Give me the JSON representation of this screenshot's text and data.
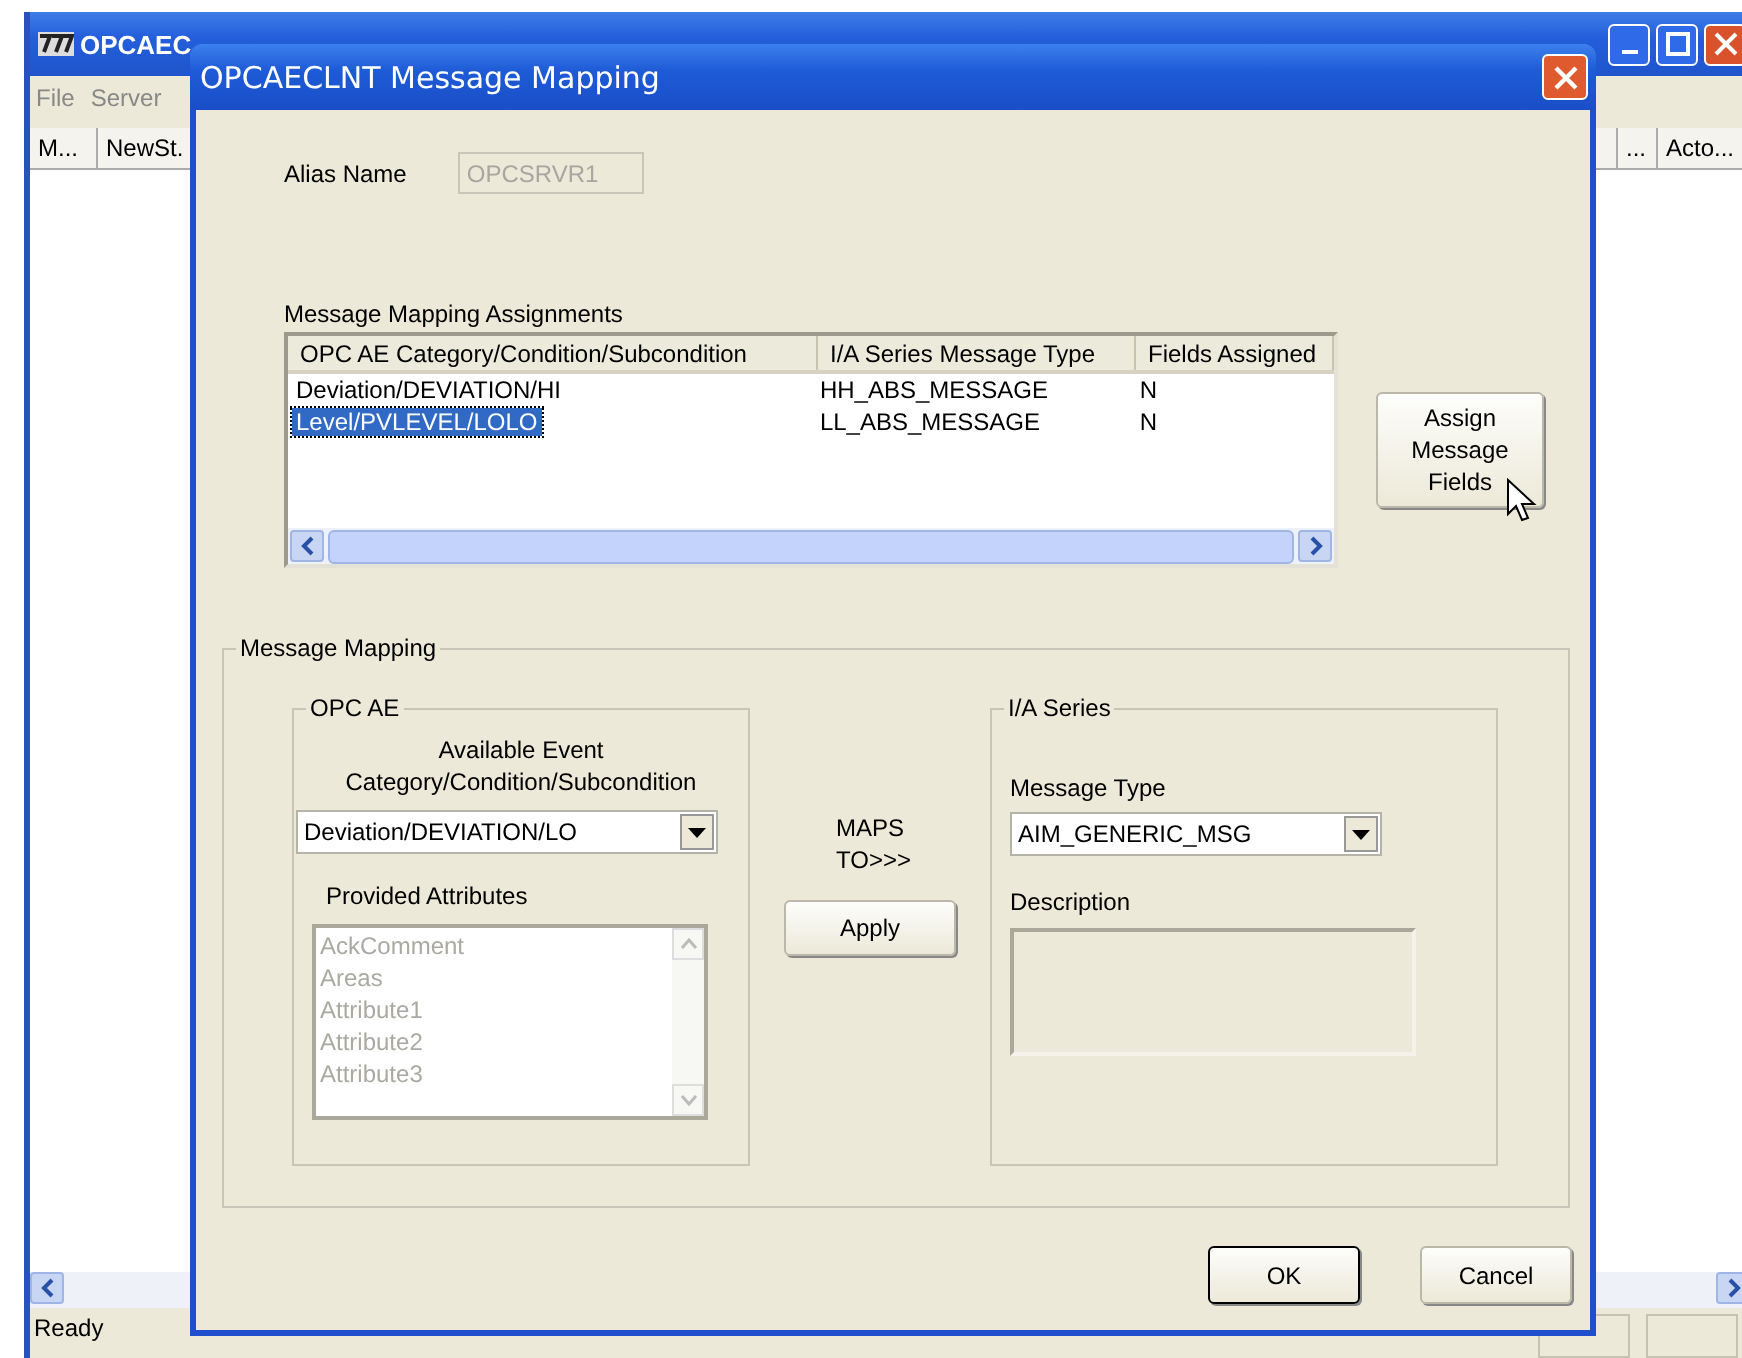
{
  "main_window": {
    "title": "OPCAEC",
    "menu": [
      "File",
      "Server"
    ],
    "columns": [
      "M...",
      "NewSt.",
      "...",
      "Acto..."
    ],
    "status": "Ready"
  },
  "dialog": {
    "title": "OPCAECLNT Message Mapping",
    "alias": {
      "label": "Alias Name",
      "value": "OPCSRVR1",
      "disabled": true
    },
    "assignments": {
      "label": "Message Mapping Assignments",
      "columns": [
        "OPC AE Category/Condition/Subcondition",
        "I/A Series Message Type",
        "Fields Assigned"
      ],
      "rows": [
        {
          "cells": [
            "Deviation/DEVIATION/HI",
            "HH_ABS_MESSAGE",
            "N"
          ],
          "selected": false
        },
        {
          "cells": [
            "Level/PVLEVEL/LOLO",
            "LL_ABS_MESSAGE",
            "N"
          ],
          "selected": true
        }
      ]
    },
    "assign_button": "Assign Message Fields",
    "mapping": {
      "title": "Message Mapping",
      "opc_ae": {
        "title": "OPC AE",
        "event_label": "Available Event Category/Condition/Subcondition",
        "event_value": "Deviation/DEVIATION/LO",
        "attributes_label": "Provided Attributes",
        "attributes_disabled": true,
        "attributes": [
          "AckComment",
          "Areas",
          "Attribute1",
          "Attribute2",
          "Attribute3"
        ]
      },
      "maps_to": "MAPS TO>>>",
      "apply": "Apply",
      "ia_series": {
        "title": "I/A Series",
        "type_label": "Message Type",
        "type_value": "AIM_GENERIC_MSG",
        "description_label": "Description"
      }
    },
    "buttons": [
      "OK",
      "Cancel"
    ]
  }
}
